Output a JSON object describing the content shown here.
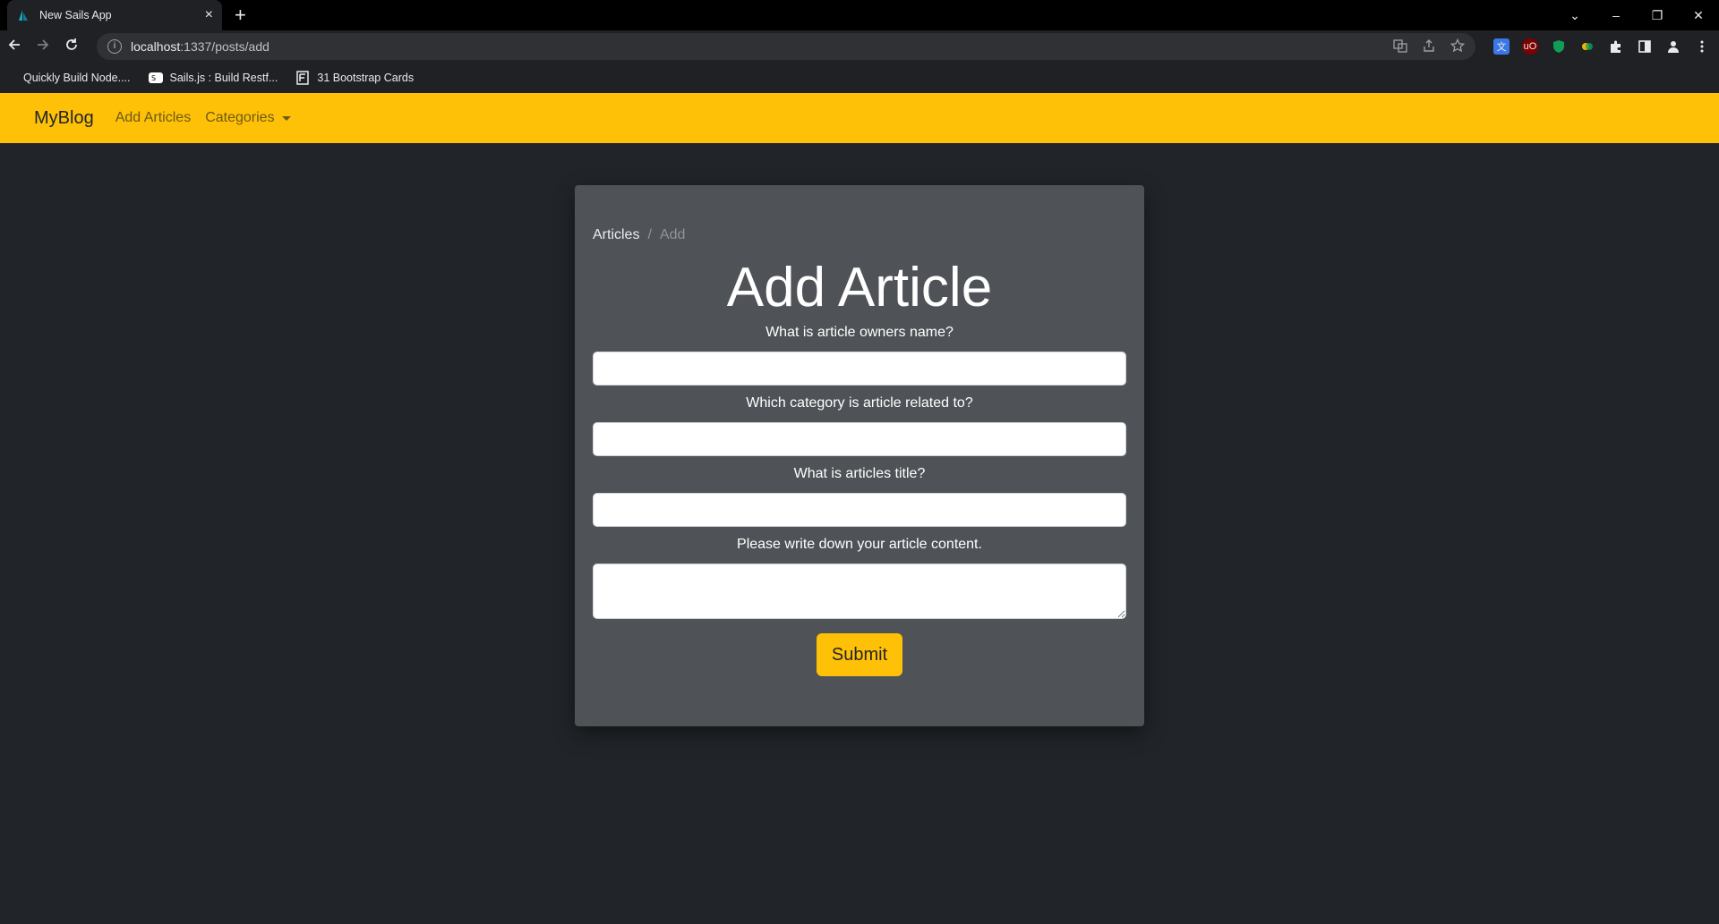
{
  "browser": {
    "tab_title": "New Sails App",
    "tab_close": "×",
    "new_tab": "+",
    "url_host": "localhost",
    "url_rest": ":1337/posts/add",
    "window_controls": [
      "⌄",
      "–",
      "❐",
      "✕"
    ],
    "bookmarks": [
      {
        "label": "Quickly Build Node....",
        "icon": "blank-page-icon"
      },
      {
        "label": "Sails.js : Build Restf...",
        "icon": "sails-logo-icon"
      },
      {
        "label": "31 Bootstrap Cards",
        "icon": "bootstrap-cards-icon"
      }
    ]
  },
  "navbar": {
    "brand": "MyBlog",
    "links": [
      "Add Articles",
      "Categories"
    ]
  },
  "breadcrumb": {
    "parent": "Articles",
    "separator": "/",
    "current": "Add"
  },
  "form": {
    "title": "Add Article",
    "labels": {
      "owner": "What is article owners name?",
      "category": "Which category is article related to?",
      "title": "What is articles title?",
      "content": "Please write down your article content."
    },
    "values": {
      "owner": "",
      "category": "",
      "title": "",
      "content": ""
    },
    "submit_label": "Submit"
  },
  "colors": {
    "navbar_bg": "#ffc107",
    "page_bg": "#212529",
    "card_bg": "#4f5357",
    "button_bg": "#ffc107"
  }
}
